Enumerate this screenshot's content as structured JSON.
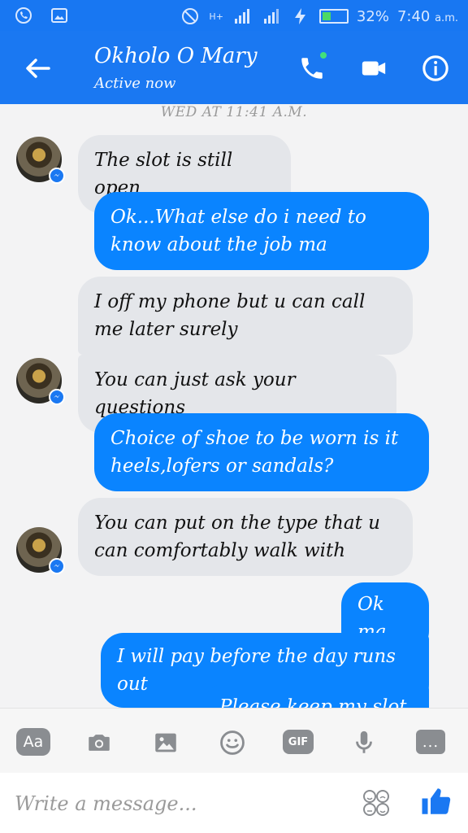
{
  "status_bar": {
    "network_label": "H+",
    "battery_percent": "32%",
    "time": "7:40",
    "time_suffix": "a.m.",
    "battery_level": 0.32
  },
  "header": {
    "contact_name": "Okholo O Mary",
    "status": "Active now"
  },
  "conversation": {
    "timestamp": "WED AT 11:41 A.M.",
    "messages": [
      {
        "direction": "in",
        "text": "The slot is still open"
      },
      {
        "direction": "out",
        "text": "Ok...What else do i need to know about the job ma"
      },
      {
        "direction": "in",
        "text": "I off my phone but u can call me later surely"
      },
      {
        "direction": "in",
        "text": "You can just ask your questions"
      },
      {
        "direction": "out",
        "text": "Choice of shoe to be worn is it heels,lofers or sandals?"
      },
      {
        "direction": "in",
        "text": "You can put on the type that u can comfortably walk with"
      },
      {
        "direction": "out",
        "text": "Ok ma"
      },
      {
        "direction": "out",
        "text": "I will pay before the day runs out"
      },
      {
        "direction": "out",
        "text": "Please keep my slot o"
      }
    ]
  },
  "toolbar": {
    "text_format_label": "Aa",
    "gif_label": "GIF",
    "more_label": "..."
  },
  "composer": {
    "placeholder": "Write a message..."
  },
  "colors": {
    "brand_blue": "#1a78f2",
    "outgoing_bubble": "#0a84ff",
    "incoming_bubble": "#e4e6ea"
  }
}
